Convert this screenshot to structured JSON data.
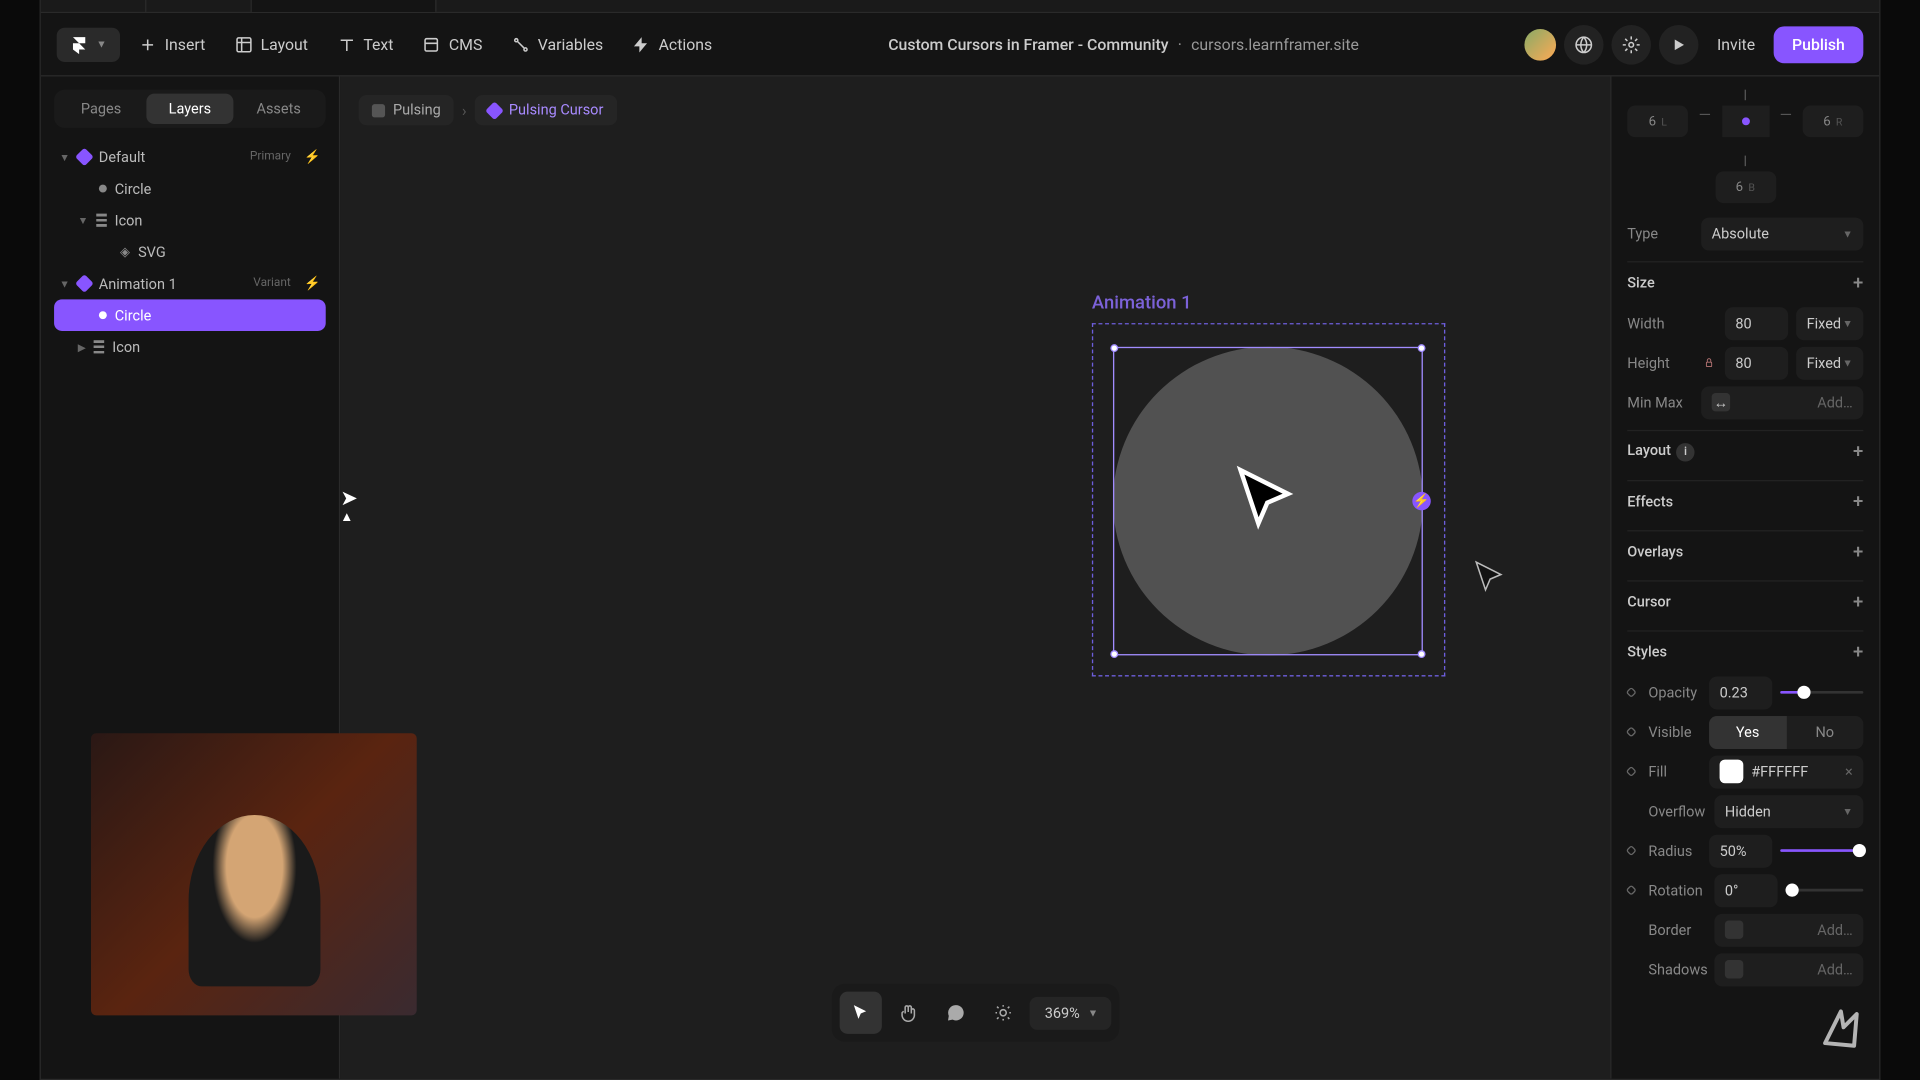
{
  "toolbar": {
    "insert": "Insert",
    "layout": "Layout",
    "text": "Text",
    "cms": "CMS",
    "variables": "Variables",
    "actions": "Actions",
    "title": "Custom Cursors in Framer - Community",
    "sep": "·",
    "subtitle": "cursors.learnframer.site",
    "invite": "Invite",
    "publish": "Publish"
  },
  "left_tabs": {
    "pages": "Pages",
    "layers": "Layers",
    "assets": "Assets"
  },
  "layers": {
    "default": "Default",
    "default_badge": "Primary",
    "circle1": "Circle",
    "icon1": "Icon",
    "svg": "SVG",
    "anim1": "Animation 1",
    "anim1_badge": "Variant",
    "circle2": "Circle",
    "icon2": "Icon"
  },
  "breadcrumb": {
    "pulsing": "Pulsing",
    "cursor": "Pulsing Cursor"
  },
  "canvas_label": "Animation 1",
  "zoom": "369%",
  "right": {
    "pos_l_val": "6",
    "pos_l_lbl": "L",
    "pos_r_val": "6",
    "pos_r_lbl": "R",
    "pos_b_val": "6",
    "pos_b_lbl": "B",
    "type": "Type",
    "type_val": "Absolute",
    "size_hdr": "Size",
    "width": "Width",
    "width_val": "80",
    "width_mode": "Fixed",
    "height": "Height",
    "height_val": "80",
    "height_mode": "Fixed",
    "minmax": "Min Max",
    "minmax_val": "Add…",
    "layout_hdr": "Layout",
    "effects_hdr": "Effects",
    "overlays_hdr": "Overlays",
    "cursor_hdr": "Cursor",
    "styles_hdr": "Styles",
    "opacity": "Opacity",
    "opacity_val": "0.23",
    "visible": "Visible",
    "yes": "Yes",
    "no": "No",
    "fill": "Fill",
    "fill_val": "#FFFFFF",
    "overflow": "Overflow",
    "overflow_val": "Hidden",
    "radius": "Radius",
    "radius_val": "50%",
    "rotation": "Rotation",
    "rotation_val": "0°",
    "border": "Border",
    "border_val": "Add…",
    "shadows": "Shadows",
    "shadows_val": "Add…"
  }
}
